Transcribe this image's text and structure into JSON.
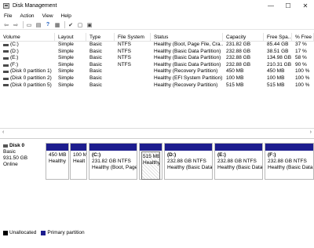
{
  "window": {
    "title": "Disk Management"
  },
  "menu": [
    "File",
    "Action",
    "View",
    "Help"
  ],
  "toolbar": {
    "back_icon": "back-arrow-icon",
    "forward_icon": "forward-arrow-icon"
  },
  "volume_table": {
    "headers": [
      "Volume",
      "Layout",
      "Type",
      "File System",
      "Status",
      "Capacity",
      "Free Spa...",
      "% Free"
    ],
    "rows": [
      [
        "(C:)",
        "Simple",
        "Basic",
        "NTFS",
        "Healthy (Boot, Page File, Cra...",
        "231.82 GB",
        "85.44 GB",
        "37 %"
      ],
      [
        "(D:)",
        "Simple",
        "Basic",
        "NTFS",
        "Healthy (Basic Data Partition)",
        "232.88 GB",
        "38.51 GB",
        "17 %"
      ],
      [
        "(E:)",
        "Simple",
        "Basic",
        "NTFS",
        "Healthy (Basic Data Partition)",
        "232.88 GB",
        "134.98 GB",
        "58 %"
      ],
      [
        "(F:)",
        "Simple",
        "Basic",
        "NTFS",
        "Healthy (Basic Data Partition)",
        "232.88 GB",
        "210.31 GB",
        "90 %"
      ],
      [
        "(Disk 0 partition 1)",
        "Simple",
        "Basic",
        "",
        "Healthy (Recovery Partition)",
        "450 MB",
        "450 MB",
        "100 %"
      ],
      [
        "(Disk 0 partition 2)",
        "Simple",
        "Basic",
        "",
        "Healthy (EFI System Partition)",
        "100 MB",
        "100 MB",
        "100 %"
      ],
      [
        "(Disk 0 partition 5)",
        "Simple",
        "Basic",
        "",
        "Healthy (Recovery Partition)",
        "515 MB",
        "515 MB",
        "100 %"
      ]
    ]
  },
  "disk": {
    "name": "Disk 0",
    "type": "Basic",
    "size": "931.50 GB",
    "status": "Online",
    "partitions": [
      {
        "title": "",
        "size": "450 MB",
        "status": "Healthy"
      },
      {
        "title": "",
        "size": "100 M",
        "status": "Healt"
      },
      {
        "title": "(C:)",
        "size": "231.82 GB NTFS",
        "status": "Healthy (Boot, Page"
      },
      {
        "title": "",
        "size": "515 MB",
        "status": "Healthy"
      },
      {
        "title": "(D:)",
        "size": "232.88 GB NTFS",
        "status": "Healthy (Basic Data"
      },
      {
        "title": "(E:)",
        "size": "232.88 GB NTFS",
        "status": "Healthy (Basic Data"
      },
      {
        "title": "(F:)",
        "size": "232.88 GB NTFS",
        "status": "Healthy (Basic Data"
      }
    ]
  },
  "legend": [
    {
      "label": "Unallocated",
      "color": "#000000"
    },
    {
      "label": "Primary partition",
      "color": "#1d1d8e"
    }
  ],
  "colors": {
    "partition_stripe": "#1d1d8e"
  }
}
